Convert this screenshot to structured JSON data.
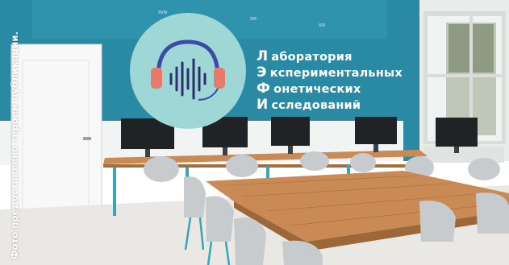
{
  "photo": {
    "credit": "Фото предоставлено героем публикации.",
    "wall_sign": {
      "lines": [
        {
          "initial": "Л",
          "rest": "аборатория"
        },
        {
          "initial": "Э",
          "rest": "кспериментальных"
        },
        {
          "initial": "Ф",
          "rest": "онетических"
        },
        {
          "initial": "И",
          "rest": "сследований"
        }
      ]
    },
    "top_board_numbers": [
      "XVIII",
      "XIX",
      "XIX"
    ],
    "icons": [
      "headphones-soundwave-logo"
    ],
    "colors": {
      "wall_teal": "#2a8aa4",
      "wall_white": "#f4f6f5",
      "logo_circle": "#9ed7d5",
      "table_wood": "#c98a55",
      "chair": "#c7cbcd",
      "monitor": "#1f2326"
    }
  }
}
